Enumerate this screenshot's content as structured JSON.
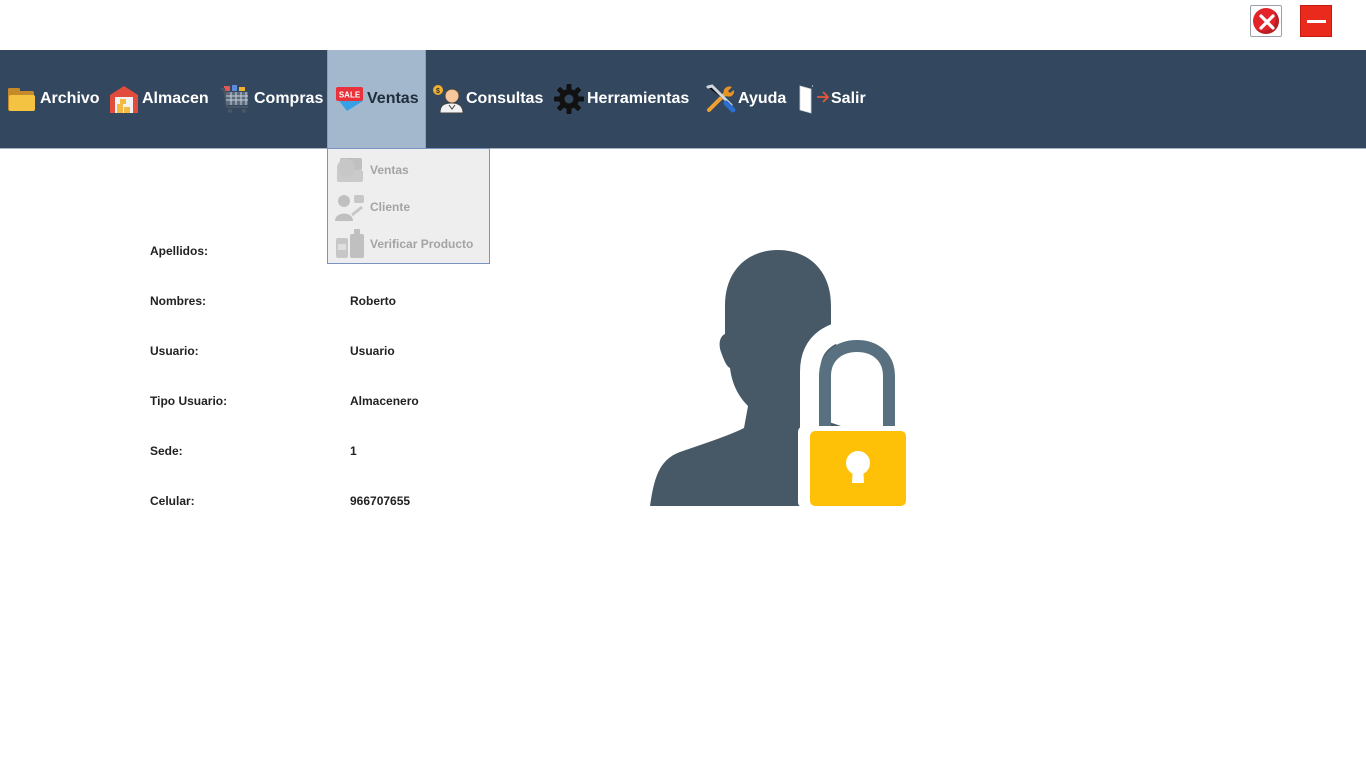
{
  "window": {
    "close_icon": "close-icon",
    "minimize_icon": "minimize-icon"
  },
  "menubar": {
    "background": "#33485e",
    "items": [
      {
        "label": "Archivo",
        "icon": "folder-icon"
      },
      {
        "label": "Almacen",
        "icon": "warehouse-icon"
      },
      {
        "label": "Compras",
        "icon": "shopping-cart-icon"
      },
      {
        "label": "Ventas",
        "icon": "sale-tag-icon",
        "active": true
      },
      {
        "label": "Consultas",
        "icon": "consultant-icon"
      },
      {
        "label": "Herramientas",
        "icon": "gear-icon"
      },
      {
        "label": "Ayuda",
        "icon": "tools-icon"
      },
      {
        "label": "Salir",
        "icon": "exit-door-icon"
      }
    ]
  },
  "dropdown": {
    "items": [
      {
        "label": "Ventas",
        "icon": "cash-register-icon"
      },
      {
        "label": "Cliente",
        "icon": "client-icon"
      },
      {
        "label": "Verificar Producto",
        "icon": "product-icon"
      }
    ]
  },
  "user_info": {
    "apellidos_label": "Apellidos:",
    "apellidos_value": "",
    "nombres_label": "Nombres:",
    "nombres_value": "Roberto",
    "usuario_label": "Usuario:",
    "usuario_value": "Usuario",
    "tipo_label": "Tipo Usuario:",
    "tipo_value": "Almacenero",
    "sede_label": "Sede:",
    "sede_value": "1",
    "celular_label": "Celular:",
    "celular_value": "966707655"
  },
  "picture": {
    "icon": "user-lock-icon",
    "silhouette_color": "#475966",
    "lock_color": "#ffc107"
  }
}
